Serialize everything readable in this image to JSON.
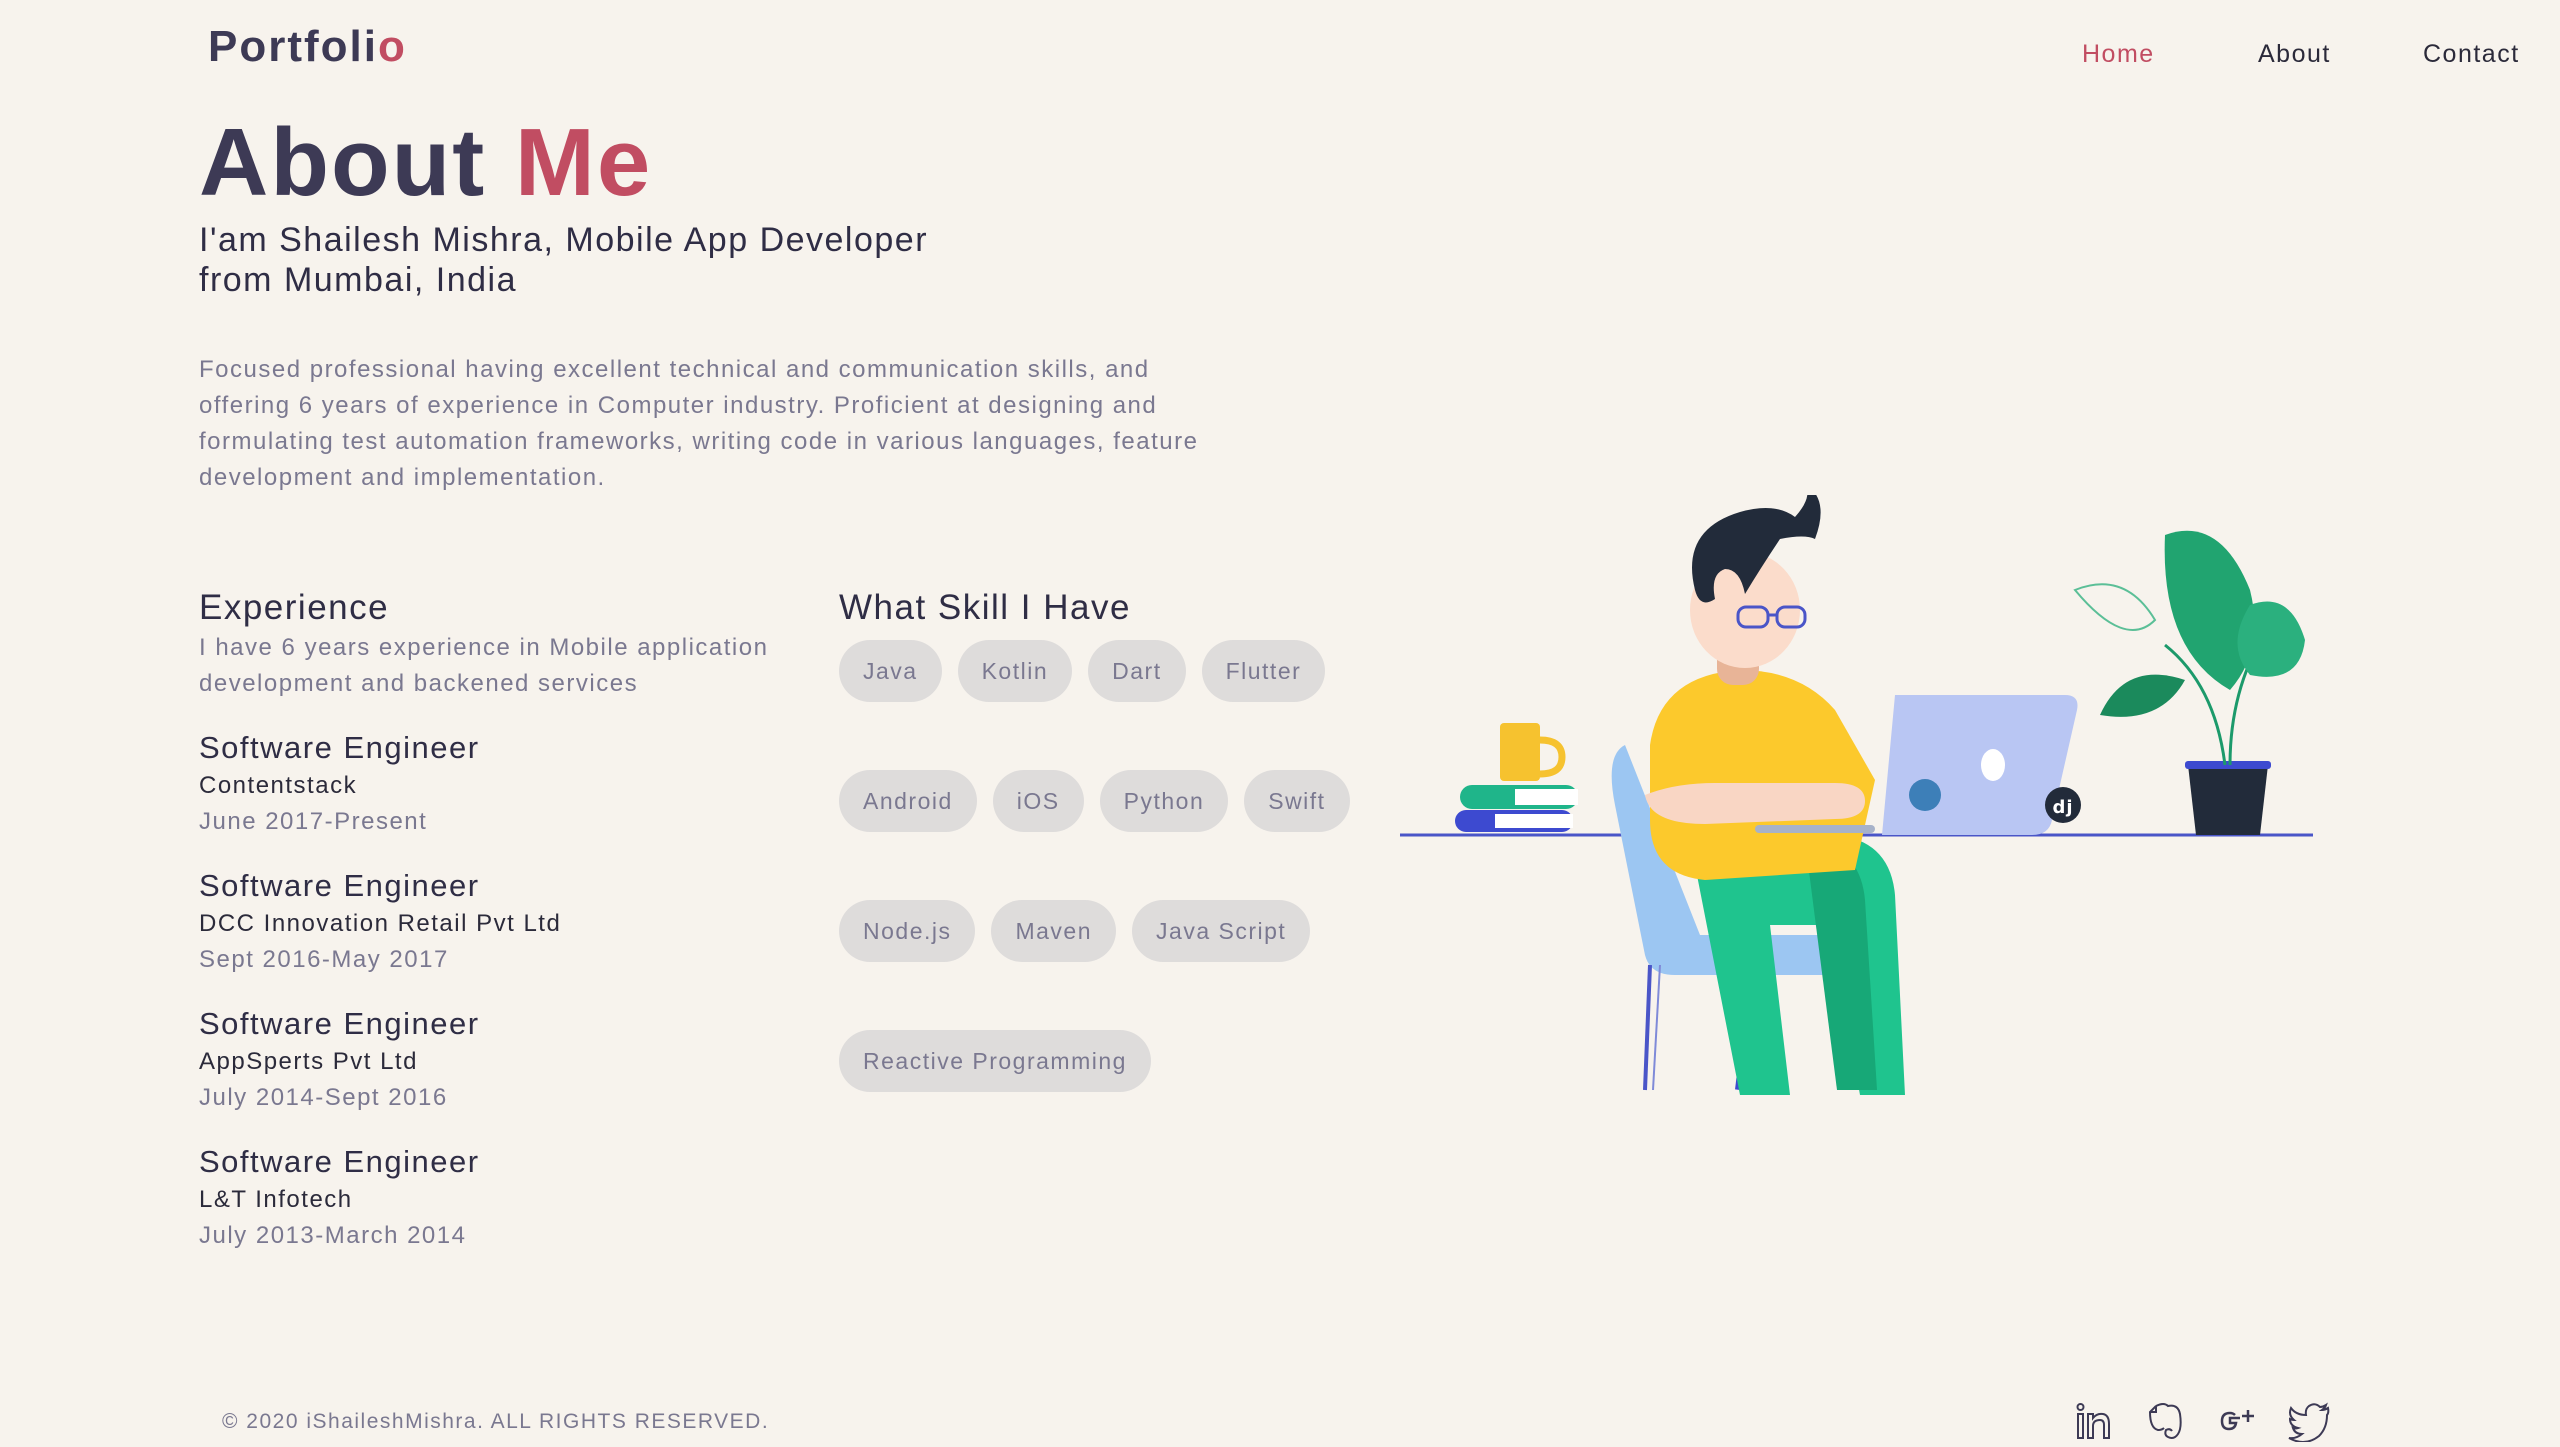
{
  "logo": {
    "main": "Portfoli",
    "accent": "o"
  },
  "nav": {
    "home": "Home",
    "about": "About",
    "contact": "Contact"
  },
  "hero": {
    "title_main": "About ",
    "title_accent": "Me",
    "subtitle_line1": "I'am Shailesh Mishra, Mobile App Developer",
    "subtitle_line2": "from Mumbai, India",
    "summary": "Focused professional having excellent technical and communication skills, and offering 6 years of experience in Computer industry. Proficient at designing and formulating test automation frameworks, writing code in various languages, feature development and implementation."
  },
  "experience": {
    "heading": "Experience",
    "intro": "I have 6 years experience in Mobile application development and backened services",
    "jobs": [
      {
        "role": "Software Engineer",
        "company": "Contentstack",
        "dates": "June 2017-Present"
      },
      {
        "role": "Software Engineer",
        "company": "DCC Innovation Retail Pvt Ltd",
        "dates": "Sept 2016-May 2017"
      },
      {
        "role": "Software Engineer",
        "company": "AppSperts Pvt Ltd",
        "dates": "July 2014-Sept 2016"
      },
      {
        "role": "Software Engineer",
        "company": "L&T Infotech",
        "dates": "July 2013-March 2014"
      }
    ]
  },
  "skills": {
    "heading": "What Skill I Have",
    "items": [
      "Java",
      "Kotlin",
      "Dart",
      "Flutter",
      "Android",
      "iOS",
      "Python",
      "Swift",
      "Node.js",
      "Maven",
      "Java Script",
      "Reactive Programming"
    ]
  },
  "footer": {
    "copyright": "© 2020 iShaileshMishra. ALL RIGHTS RESERVED."
  },
  "social_icons": [
    "linkedin-icon",
    "evernote-icon",
    "google-plus-icon",
    "twitter-icon"
  ],
  "colors": {
    "accent": "#c14d62",
    "text_dark": "#3d3a55",
    "text_muted": "#7a7890",
    "background": "#f7f3ed",
    "chip": "#dedcdb"
  }
}
